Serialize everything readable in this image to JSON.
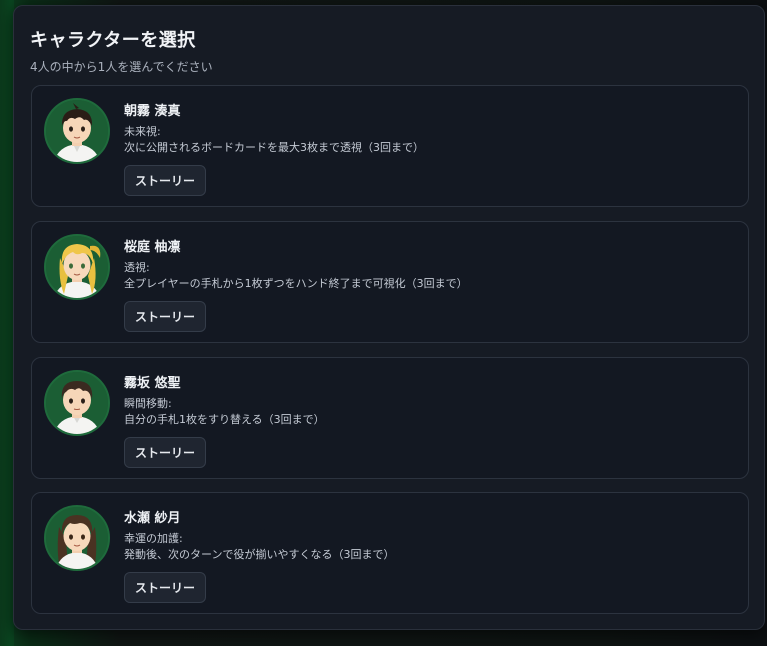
{
  "dialog": {
    "title": "キャラクターを選択",
    "subtitle": "4人の中から1人を選んでください"
  },
  "characters": [
    {
      "name": "朝霧 湊真",
      "ability_name": "未来視:",
      "ability_desc": "次に公開されるボードカードを最大3枚まで透視（3回まで）",
      "story_label": "ストーリー",
      "avatar_icon": "boy-short-dark-hair-portrait"
    },
    {
      "name": "桜庭 柚凛",
      "ability_name": "透視:",
      "ability_desc": "全プレイヤーの手札から1枚ずつをハンド終了まで可視化（3回まで）",
      "story_label": "ストーリー",
      "avatar_icon": "girl-blonde-ponytail-portrait"
    },
    {
      "name": "霧坂 悠聖",
      "ability_name": "瞬間移動:",
      "ability_desc": "自分の手札1枚をすり替える（3回まで）",
      "story_label": "ストーリー",
      "avatar_icon": "boy-brown-hair-portrait"
    },
    {
      "name": "水瀬 紗月",
      "ability_name": "幸運の加護:",
      "ability_desc": "発動後、次のターンで役が揃いやすくなる（3回まで）",
      "story_label": "ストーリー",
      "avatar_icon": "girl-long-brown-hair-portrait"
    }
  ],
  "colors": {
    "panel_bg": "#161b24",
    "card_bg": "#131822",
    "avatar_bg": "#1b5e34",
    "button_bg": "#1f2530"
  }
}
